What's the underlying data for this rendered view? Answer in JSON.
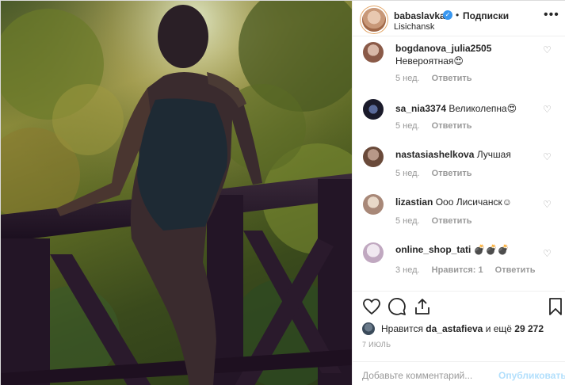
{
  "header": {
    "username": "babaslavka",
    "separator": "•",
    "follow_label": "Подписки",
    "location": "Lisichansk",
    "more": "•••"
  },
  "comments": [
    {
      "user": "bogdanova_julia2505",
      "text": "Невероятная😍",
      "age": "5 нед.",
      "likes": "",
      "reply": "Ответить"
    },
    {
      "user": "sa_nia3374",
      "text": "Великолепна😍",
      "age": "5 нед.",
      "likes": "",
      "reply": "Ответить"
    },
    {
      "user": "nastasiashelkova",
      "text": "Лучшая",
      "age": "5 нед.",
      "likes": "",
      "reply": "Ответить"
    },
    {
      "user": "lizastian",
      "text": "Ооо Лисичанск☺",
      "age": "5 нед.",
      "likes": "",
      "reply": "Ответить"
    },
    {
      "user": "online_shop_tati",
      "text": "💣💣💣",
      "age": "3 нед.",
      "likes": "Нравится: 1",
      "reply": "Ответить"
    }
  ],
  "likes": {
    "prefix": "Нравится",
    "user": "da_astafieva",
    "suffix": "и ещё",
    "count": "29 272"
  },
  "date": "7 ИЮЛЬ",
  "add_comment": {
    "placeholder": "Добавьте комментарий...",
    "post_label": "Опубликовать"
  },
  "icons": {
    "like": "heart-icon",
    "comment": "comment-icon",
    "share": "share-icon",
    "save": "bookmark-icon",
    "verified": "verified-badge-icon",
    "comment_like": "small-heart-icon"
  },
  "colors": {
    "link_disabled": "#b2dffc",
    "verified": "#3897f0",
    "muted": "#999999",
    "text": "#262626"
  }
}
